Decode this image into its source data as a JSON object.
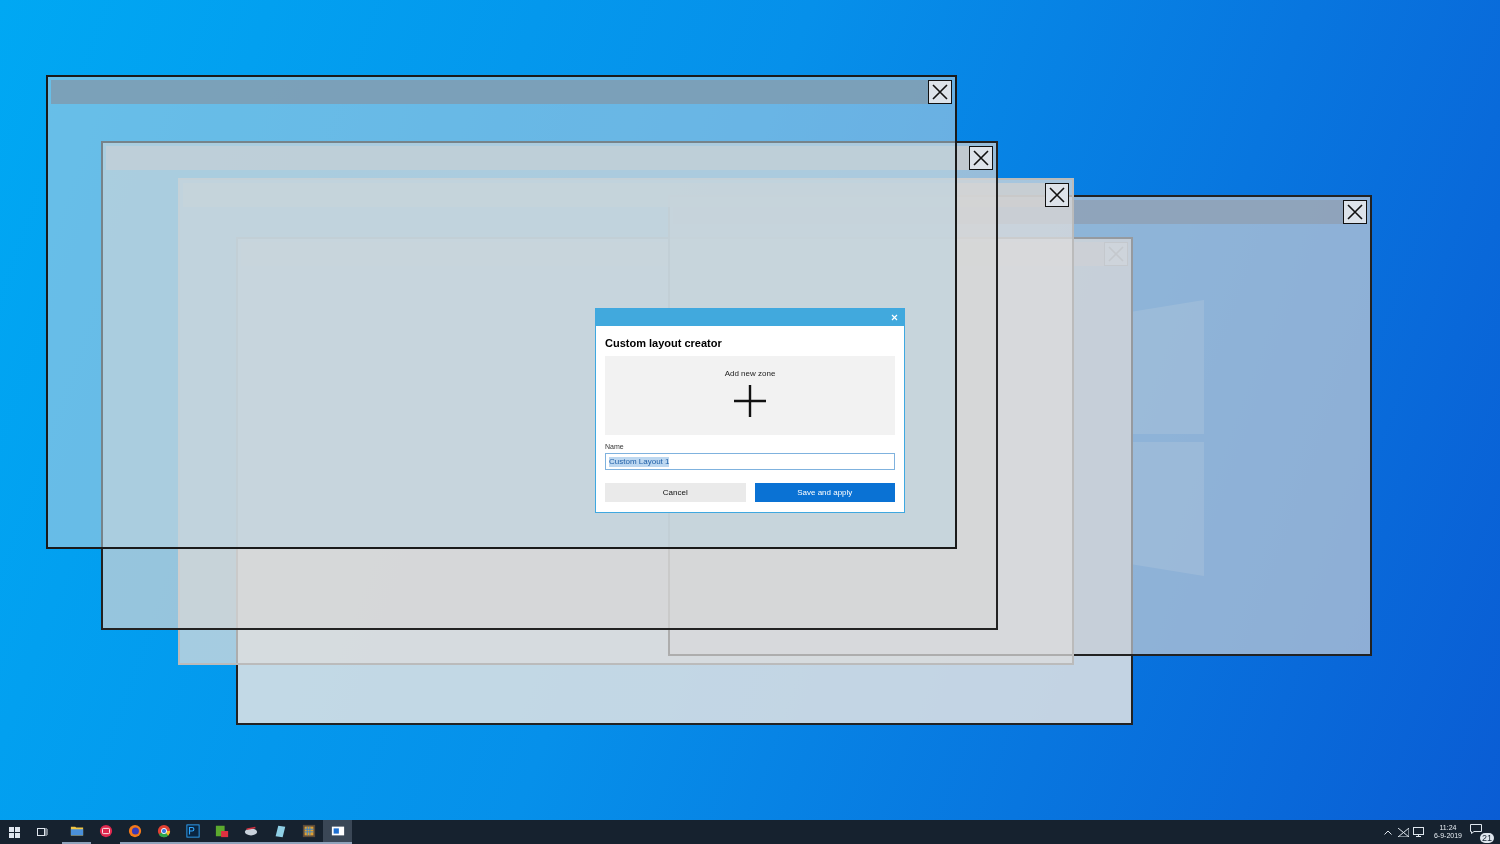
{
  "dialog": {
    "title": "Custom layout creator",
    "add_zone_label": "Add new zone",
    "name_label": "Name",
    "name_value": "Custom Layout 1",
    "cancel": "Cancel",
    "save": "Save and apply"
  },
  "taskbar": {
    "apps": [
      {
        "kind": "folder",
        "running": true,
        "selected": false
      },
      {
        "kind": "camera",
        "running": false,
        "selected": false
      },
      {
        "kind": "fox",
        "running": true,
        "selected": false
      },
      {
        "kind": "wheel",
        "running": true,
        "selected": false
      },
      {
        "kind": "ps",
        "running": true,
        "selected": false
      },
      {
        "kind": "gift",
        "running": true,
        "selected": false
      },
      {
        "kind": "disc",
        "running": true,
        "selected": false
      },
      {
        "kind": "tablet",
        "running": true,
        "selected": false
      },
      {
        "kind": "grid",
        "running": true,
        "selected": false
      },
      {
        "kind": "window",
        "running": true,
        "selected": true
      }
    ]
  },
  "clock": {
    "time": "11:24",
    "date": "6-9-2019"
  },
  "notifications": {
    "count": "21"
  }
}
